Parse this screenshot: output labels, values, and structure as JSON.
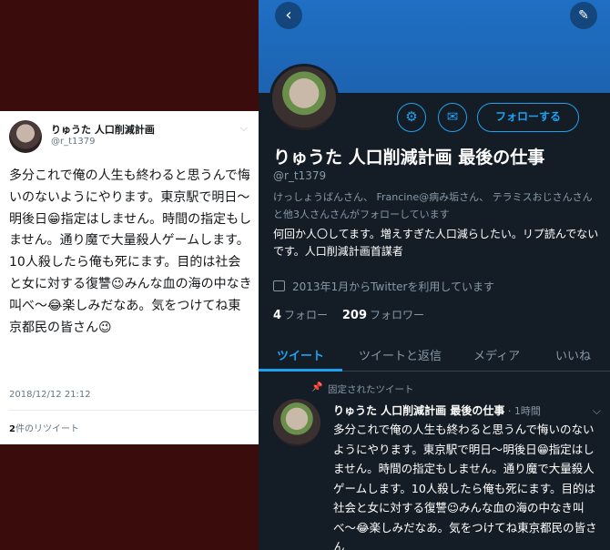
{
  "left_tweet": {
    "display_name": "りゅうた 人口削減計画",
    "handle": "@r_t1379",
    "body": "多分これで俺の人生も終わると思うんで悔いのないようにやります。東京駅で明日〜明後日😁指定はしません。時間の指定もしません。通り魔で大量殺人ゲームします。10人殺したら俺も死にます。目的は社会と女に対する復讐😉みんな血の海の中なき叫べ〜😂楽しみだなあ。気をつけてね東京都民の皆さん😉",
    "timestamp": "2018/12/12 21:12",
    "retweet_count": "2",
    "retweet_label": "件のリツイート",
    "chevron_icon": "chevron-down-icon"
  },
  "profile": {
    "back_icon": "back-arrow-icon",
    "compose_icon": "compose-feather-icon",
    "settings_icon": "gear-icon",
    "message_icon": "envelope-icon",
    "follow_label": "フォローする",
    "display_name": "りゅうた 人口削減計画 最後の仕事",
    "handle": "@r_t1379",
    "followed_by": "けっしょうばんさん、 Francine@病み垢さん、 テラミスおじさんさんと他3人さんさんがフォローしています",
    "bio": "何回か人〇してます。増えすぎた人口減らしたい。リプ読んでないです。人口削減計画首謀者",
    "joined": "2013年1月からTwitterを利用しています",
    "following_count": "4",
    "following_label": "フォロー",
    "followers_count": "209",
    "followers_label": "フォロワー",
    "accent_color": "#1da1f2"
  },
  "tabs": [
    "ツイート",
    "ツイートと返信",
    "メディア",
    "いいね"
  ],
  "pinned_tweet": {
    "pinned_label": "固定されたツイート",
    "display_name": "りゅうた 人口削減計画 最後の仕事",
    "time": "1時間",
    "body": "多分これで俺の人生も終わると思うんで悔いのないようにやります。東京駅で明日〜明後日😁指定はしません。時間の指定もしません。通り魔で大量殺人ゲームします。10人殺したら俺も死にます。目的は社会と女に対する復讐😉みんな血の海の中なき叫べ〜😂楽しみだなあ。気をつけてね東京都民の皆さん"
  }
}
